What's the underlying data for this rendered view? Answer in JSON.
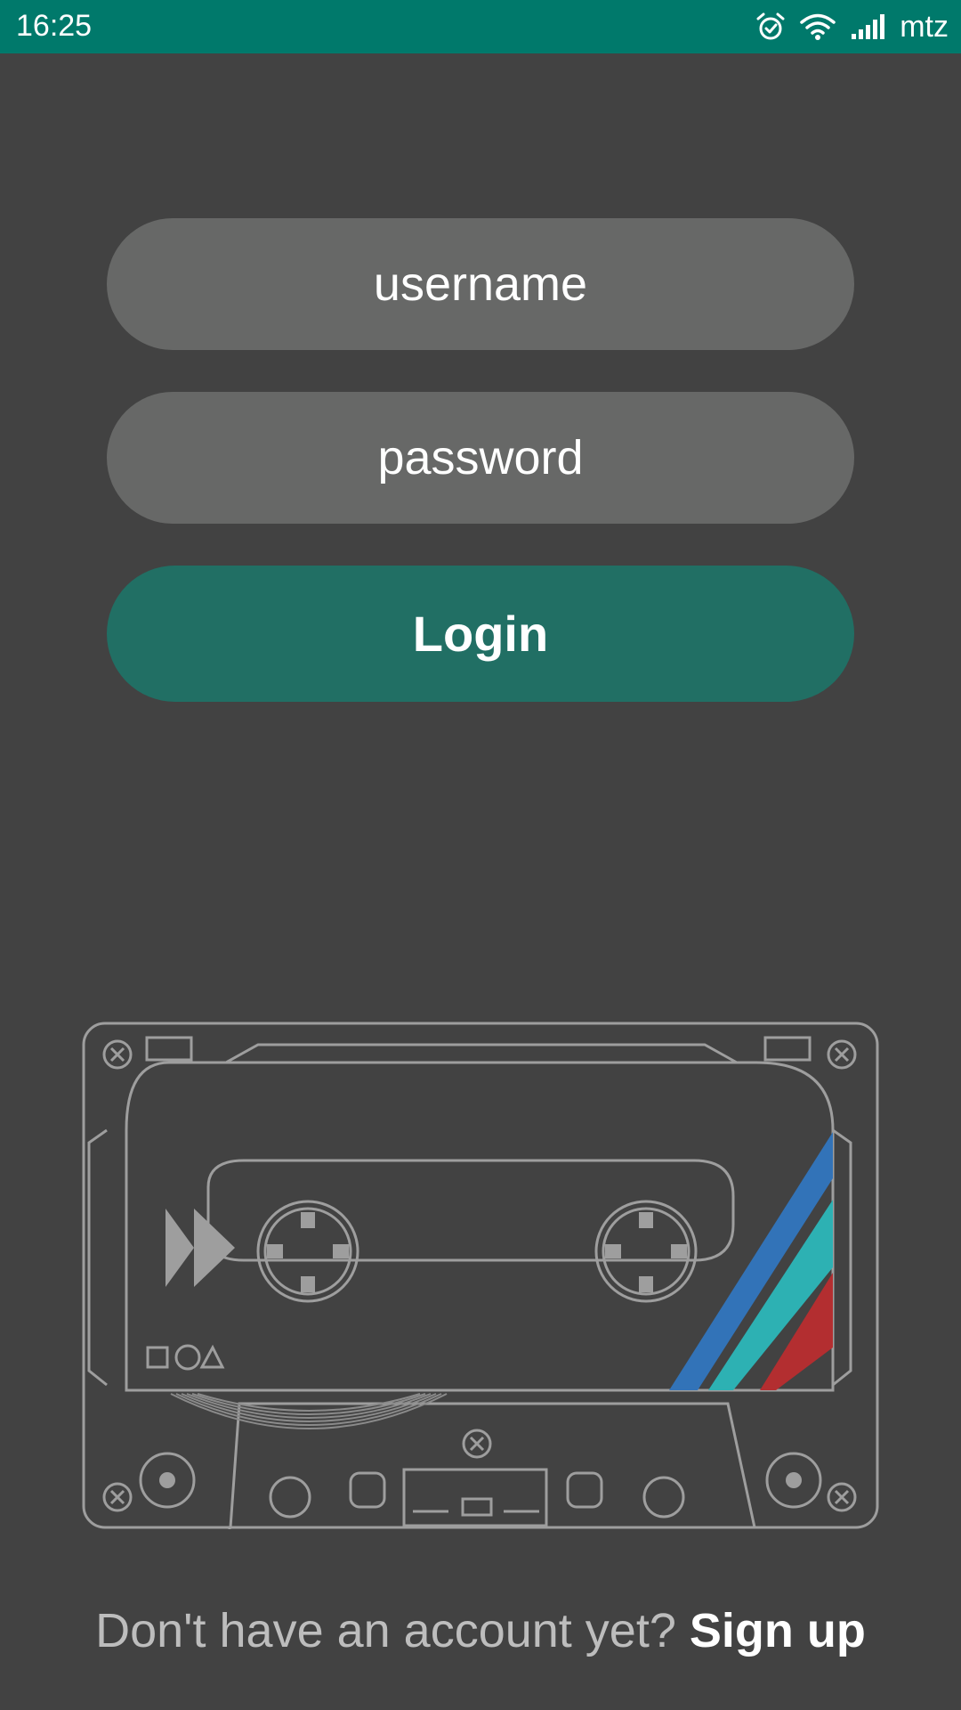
{
  "status_bar": {
    "time": "16:25",
    "carrier": "mtz",
    "icons": [
      "alarm-icon",
      "wifi-icon",
      "signal-icon"
    ]
  },
  "login_form": {
    "username_placeholder": "username",
    "username_value": "",
    "password_placeholder": "password",
    "password_value": "",
    "login_label": "Login"
  },
  "illustration": {
    "icon": "cassette-tape-icon",
    "stripe_colors": [
      "#3273B8",
      "#2DB1B3",
      "#B32E30"
    ]
  },
  "footer": {
    "prompt": "Don't have an account yet?",
    "signup_label": "Sign up"
  },
  "colors": {
    "status_bar": "#00796B",
    "background": "#424242",
    "field_background": "#676867",
    "accent": "#216F64"
  }
}
